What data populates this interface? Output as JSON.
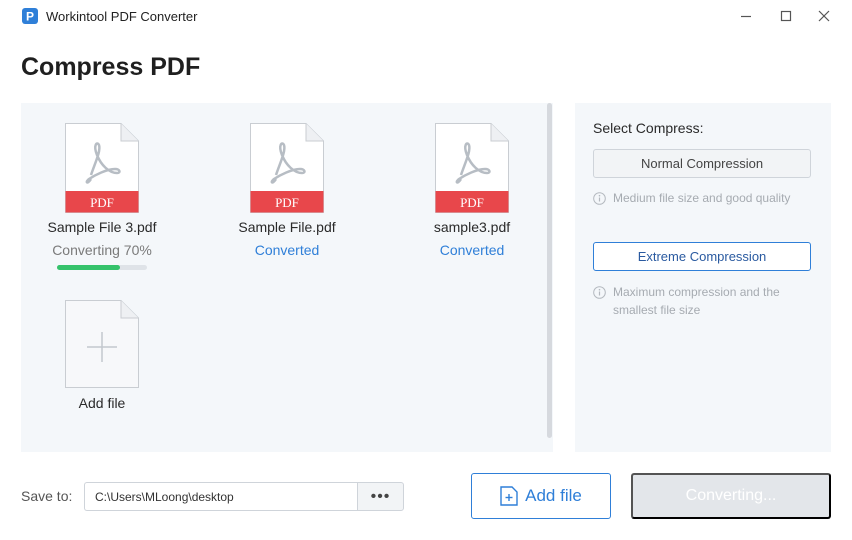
{
  "window": {
    "title": "Workintool PDF Converter",
    "logo_letter": "P",
    "accent_color": "#2f7fd8"
  },
  "page": {
    "title": "Compress PDF"
  },
  "files": [
    {
      "name": "Sample File 3.pdf",
      "status": "Converting 70%",
      "progress": 0.7,
      "badge": "PDF"
    },
    {
      "name": "Sample File.pdf",
      "status": "Converted",
      "badge": "PDF"
    },
    {
      "name": "sample3.pdf",
      "status": "Converted",
      "badge": "PDF"
    }
  ],
  "add_tile": {
    "label": "Add file"
  },
  "options": {
    "title": "Select Compress:",
    "normal_label": "Normal Compression",
    "normal_hint": "Medium file size and good quality",
    "extreme_label": "Extreme Compression",
    "extreme_hint": "Maximum compression and the smallest file size",
    "selected": "Extreme Compression"
  },
  "footer": {
    "save_label": "Save to:",
    "path_value": "C:\\Users\\MLoong\\desktop",
    "browse_label": "•••",
    "add_file_label": "Add file",
    "convert_label": "Converting..."
  },
  "colors": {
    "pdf_badge": "#e8474b",
    "progress": "#35c26b",
    "converted_text": "#2f7fd8"
  }
}
